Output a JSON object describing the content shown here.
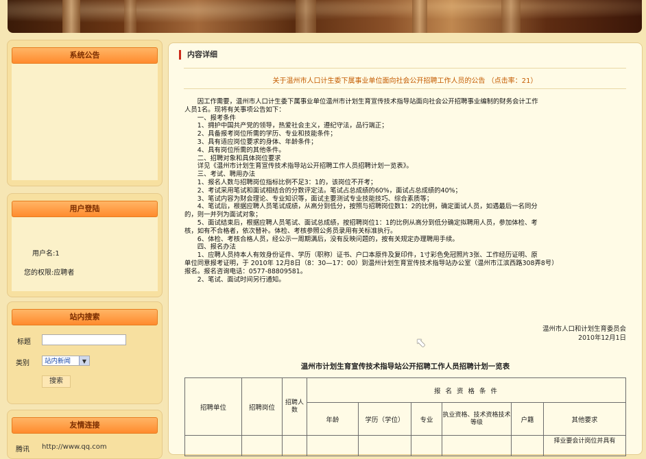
{
  "colors": {
    "accent_orange": "#ff8b2e",
    "title_orange": "#c45b00",
    "panel_bg": "#f7e0a0"
  },
  "sidebar": {
    "notice": {
      "title": "系统公告"
    },
    "login": {
      "title": "用户登陆",
      "username": "用户名:1",
      "permission": "您的权限:应聘者"
    },
    "search": {
      "title": "站内搜索",
      "field_label": "标题",
      "field_value": "",
      "category_label": "类别",
      "category_selected": "站内新闻",
      "search_button": "搜索"
    },
    "links": {
      "title": "友情连接",
      "item_name": "腾讯",
      "item_url": "http://www.qq.com"
    }
  },
  "main": {
    "section_title": "内容详细",
    "article_title": "关于温州市人口计生委下属事业单位面向社会公开招聘工作人员的公告 （点击率：21）",
    "body_lines": [
      "　　因工作需要，温州市人口计生委下属事业单位温州市计划生育宣传技术指导站面向社会公开招聘事业编制的财务会计工作",
      "人员1名。现将有关事项公告如下：",
      "　　一、报考条件",
      "　　1、拥护中国共产党的领导，热爱社会主义，遵纪守法，品行端正；",
      "　　2、具备报考岗位所需的学历、专业和技能条件；",
      "　　3、具有适应岗位要求的身体、年龄条件；",
      "　　4、具有岗位所需的其他条件。",
      "　　二、招聘对象和具体岗位要求",
      "　　详见《温州市计划生育宣传技术指导站公开招聘工作人员招聘计划一览表》。",
      "　　三、考试、聘用办法",
      "　　1、报名人数与招聘岗位指标比例不足3：1的，该岗位不开考；",
      "　　2、考试采用笔试和面试相结合的分数评定法。笔试占总成绩的60%，面试占总成绩的40%；",
      "　　3、笔试内容为财会理论、专业知识等，面试主要测试专业技能技巧、综合素质等；",
      "　　4、笔试后，根据应聘人员笔试成绩，从高分到低分，按照与招聘岗位数1：2的比例，确定面试人员，如遇最后一名同分",
      "的，则一并列为面试对象；",
      "　　5、面试结束后，根据应聘人员笔试、面试总成绩，按招聘岗位1：1的比例从高分到低分确定拟聘用人员，参加体检、考",
      "核，如有不合格者，依次替补。体检、考核参照公务员录用有关标准执行。",
      "　　6、体检、考核合格人员，经公示一周期满后，没有反映问题的，按有关规定办理聘用手续。",
      "　　四、报名办法",
      "　　1、应聘人员持本人有效身份证件、学历（职称）证书、户口本原件及复印件，1寸彩色免冠照片3张、工作经历证明、原",
      "单位同意报考证明，于 2010年 12月8日（8：30—17：00）到温州计划生育宣传技术指导站办公室（温州市江滨西路308弄8号）",
      "报名。报名咨询电话：0577-88809581。",
      "　　2、笔试、面试时间另行通知。"
    ],
    "signature_org": "温州市人口和计划生育委员会",
    "signature_date": "2010年12月1日",
    "table_title": "温州市计划生育宣传技术指导站公开招聘工作人员招聘计划一览表",
    "table": {
      "col_unit": "招聘单位",
      "col_position": "招聘岗位",
      "col_count": "招聘人数",
      "group_header": "报 名 资 格 条 件",
      "sub_headers": [
        "年龄",
        "学历（学位）",
        "专业",
        "执业资格、技术资格技术等级",
        "户籍",
        "其他要求"
      ],
      "partial_row_other": "择业要会计岗位并具有"
    }
  }
}
